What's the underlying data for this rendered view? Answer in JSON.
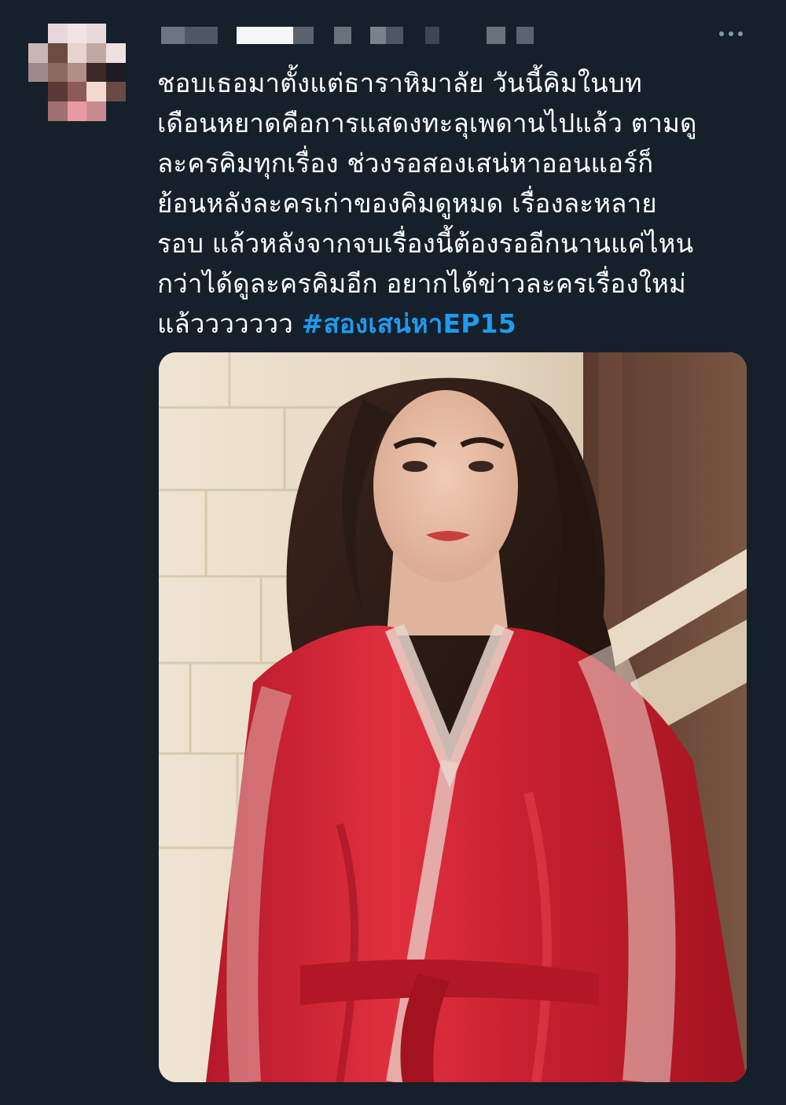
{
  "tweet": {
    "text_lines": [
      "ชอบเธอมาตั้งแต่ธาราหิมาลัย วันนี้คิมในบท",
      "เดือนหยาดคือการแสดงทะลุเพดานไปแล้ว ตามดู",
      "ละครคิมทุกเรื่อง ช่วงรอสองเสน่หาออนแอร์ก็",
      "ย้อนหลังละครเก่าของคิมดูหมด เรื่องละหลาย",
      "รอบ แล้วหลังจากจบเรื่องนี้ต้องรออีกนานแค่ไหน",
      "กว่าได้ดูละครคิมอีก อยากได้ข่าวละครเรื่องใหม่",
      "แล้ววววววว"
    ],
    "hashtag": "#สองเสน่หาEP15",
    "more_icon": "more-horizontal-icon",
    "avatar_icon": "pixelated-avatar"
  },
  "colors": {
    "background": "#15202b",
    "text": "#ffffff",
    "hashtag": "#1d9bf0",
    "muted": "#8899a6"
  }
}
